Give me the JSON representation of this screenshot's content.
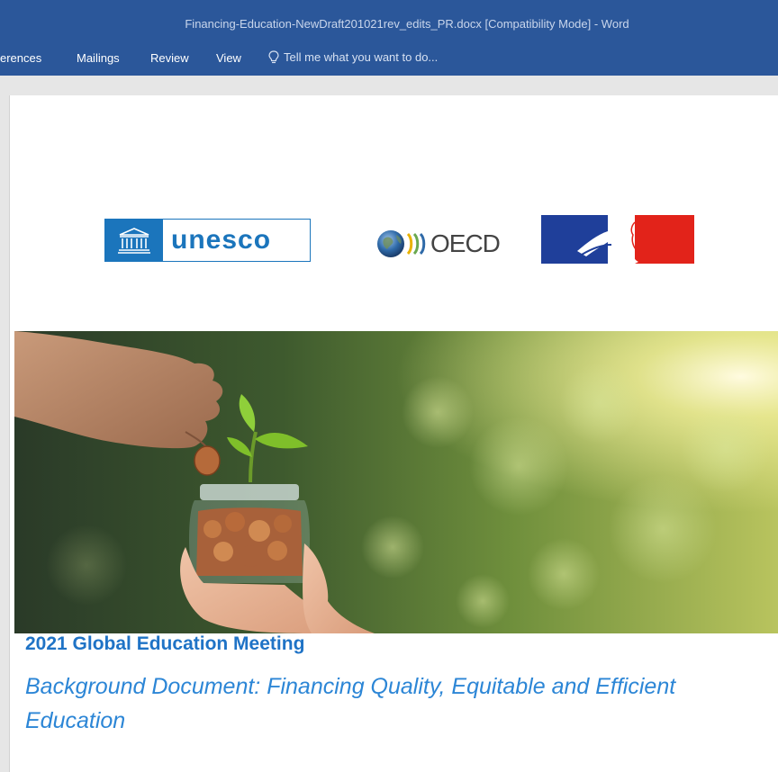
{
  "window": {
    "title": "Financing-Education-NewDraft201021rev_edits_PR.docx [Compatibility Mode] - Word"
  },
  "ribbon": {
    "tabs": [
      {
        "label": "erences"
      },
      {
        "label": "Mailings"
      },
      {
        "label": "Review"
      },
      {
        "label": "View"
      }
    ],
    "tell_me": "Tell me what you want to do..."
  },
  "document": {
    "logos": {
      "unesco": "unesco",
      "oecd": "OECD"
    },
    "heading": "2021 Global Education Meeting",
    "subtitle": "Background Document: Financing Quality, Equitable and Efficient Education"
  },
  "colors": {
    "ribbon": "#2b579a",
    "heading": "#1f73c6",
    "subtitle": "#2c86d6",
    "unesco_blue": "#1b75bc",
    "france_blue": "#1f3f9a",
    "france_red": "#e2231a"
  },
  "icons": {
    "tell_me": "lightbulb-icon"
  }
}
